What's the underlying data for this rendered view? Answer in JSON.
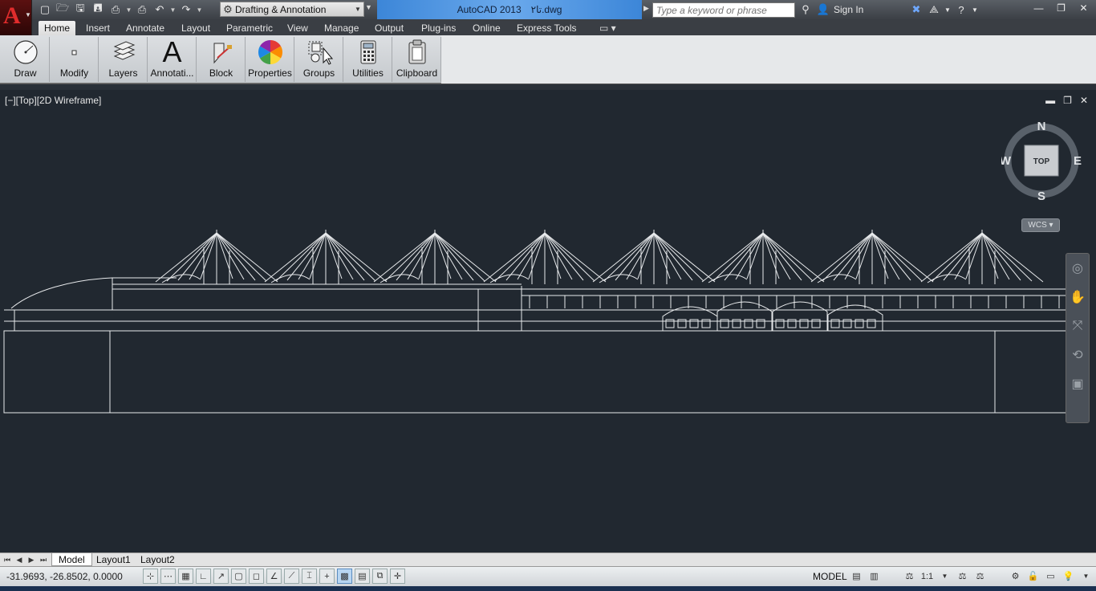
{
  "titlebar": {
    "workspace": "Drafting & Annotation",
    "app_name": "AutoCAD 2013",
    "file_name": "تا۲.dwg",
    "search_placeholder": "Type a keyword or phrase",
    "sign_in": "Sign In"
  },
  "ribbon_tabs": [
    "Home",
    "Insert",
    "Annotate",
    "Layout",
    "Parametric",
    "View",
    "Manage",
    "Output",
    "Plug-ins",
    "Online",
    "Express Tools"
  ],
  "active_tab": "Home",
  "ribbon_panels": [
    "Draw",
    "Modify",
    "Layers",
    "Annotati...",
    "Block",
    "Properties",
    "Groups",
    "Utilities",
    "Clipboard"
  ],
  "viewport": {
    "label": "[−][Top][2D Wireframe]",
    "viewcube": {
      "n": "N",
      "s": "S",
      "e": "E",
      "w": "W",
      "face": "TOP"
    },
    "ucs": "WCS"
  },
  "layout_tabs": [
    "Model",
    "Layout1",
    "Layout2"
  ],
  "status": {
    "coordinates": "-31.9693, -26.8502, 0.0000",
    "space": "MODEL",
    "scale": "1:1"
  },
  "colors": {
    "canvas": "#212830",
    "title_highlight": "#3c86d8",
    "app_icon": "#e12c2c",
    "ribbon": "#d4d7da"
  }
}
